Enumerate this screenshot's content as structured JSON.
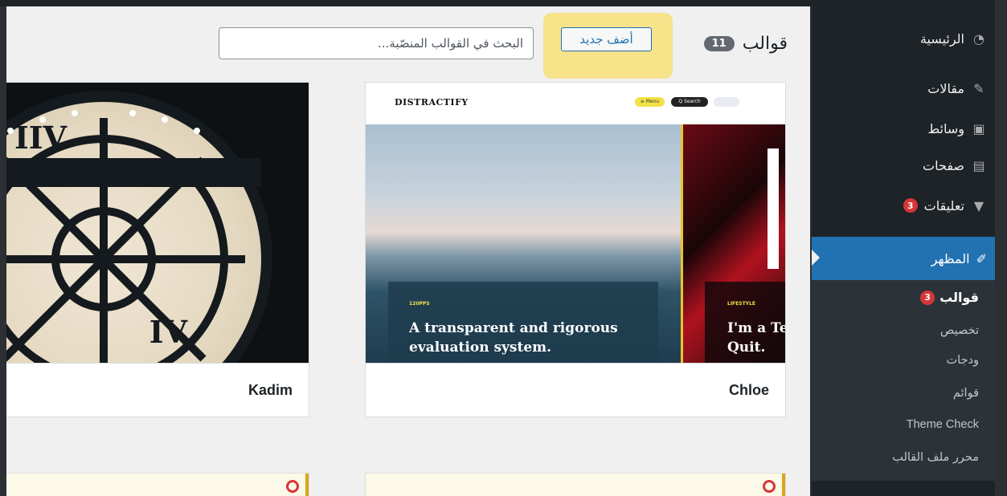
{
  "header": {
    "title": "قوالب",
    "count": "11",
    "add_new_label": "أضف جديد",
    "search_placeholder": "البحث في القوالب المنصّبة..."
  },
  "themes": [
    {
      "name": "Chloe",
      "screenshot": {
        "logo": "DISTRACTIFY",
        "menu_pill": "≡ Menu",
        "search_pill": "Q Search",
        "main_tag": "120PPS",
        "main_headline_1": "A transparent and rigorous",
        "main_headline_2": "evaluation system.",
        "side_tag": "LIFESTYLE",
        "side_headline_1": "I'm a Te",
        "side_headline_2": "Quit."
      }
    },
    {
      "name": "Kadim"
    }
  ],
  "sidebar": {
    "items": [
      {
        "label": "الرئيسية",
        "icon": "dashboard-icon"
      },
      {
        "label": "مقالات",
        "icon": "pin-icon"
      },
      {
        "label": "وسائط",
        "icon": "media-icon"
      },
      {
        "label": "صفحات",
        "icon": "pages-icon"
      },
      {
        "label": "تعليقات",
        "icon": "comment-icon",
        "badge": "3"
      },
      {
        "label": "المظهر",
        "icon": "brush-icon"
      }
    ],
    "submenu": [
      {
        "label": "قوالب",
        "badge": "3"
      },
      {
        "label": "تخصيص"
      },
      {
        "label": "ودجات"
      },
      {
        "label": "قوائم"
      },
      {
        "label": "Theme Check"
      },
      {
        "label": "محرر ملف القالب"
      }
    ]
  },
  "colors": {
    "accent": "#2271b1",
    "badge": "#d63638",
    "highlight": "#f7e38a",
    "sidebar_bg": "#1d2327",
    "notice_border": "#dba617"
  }
}
